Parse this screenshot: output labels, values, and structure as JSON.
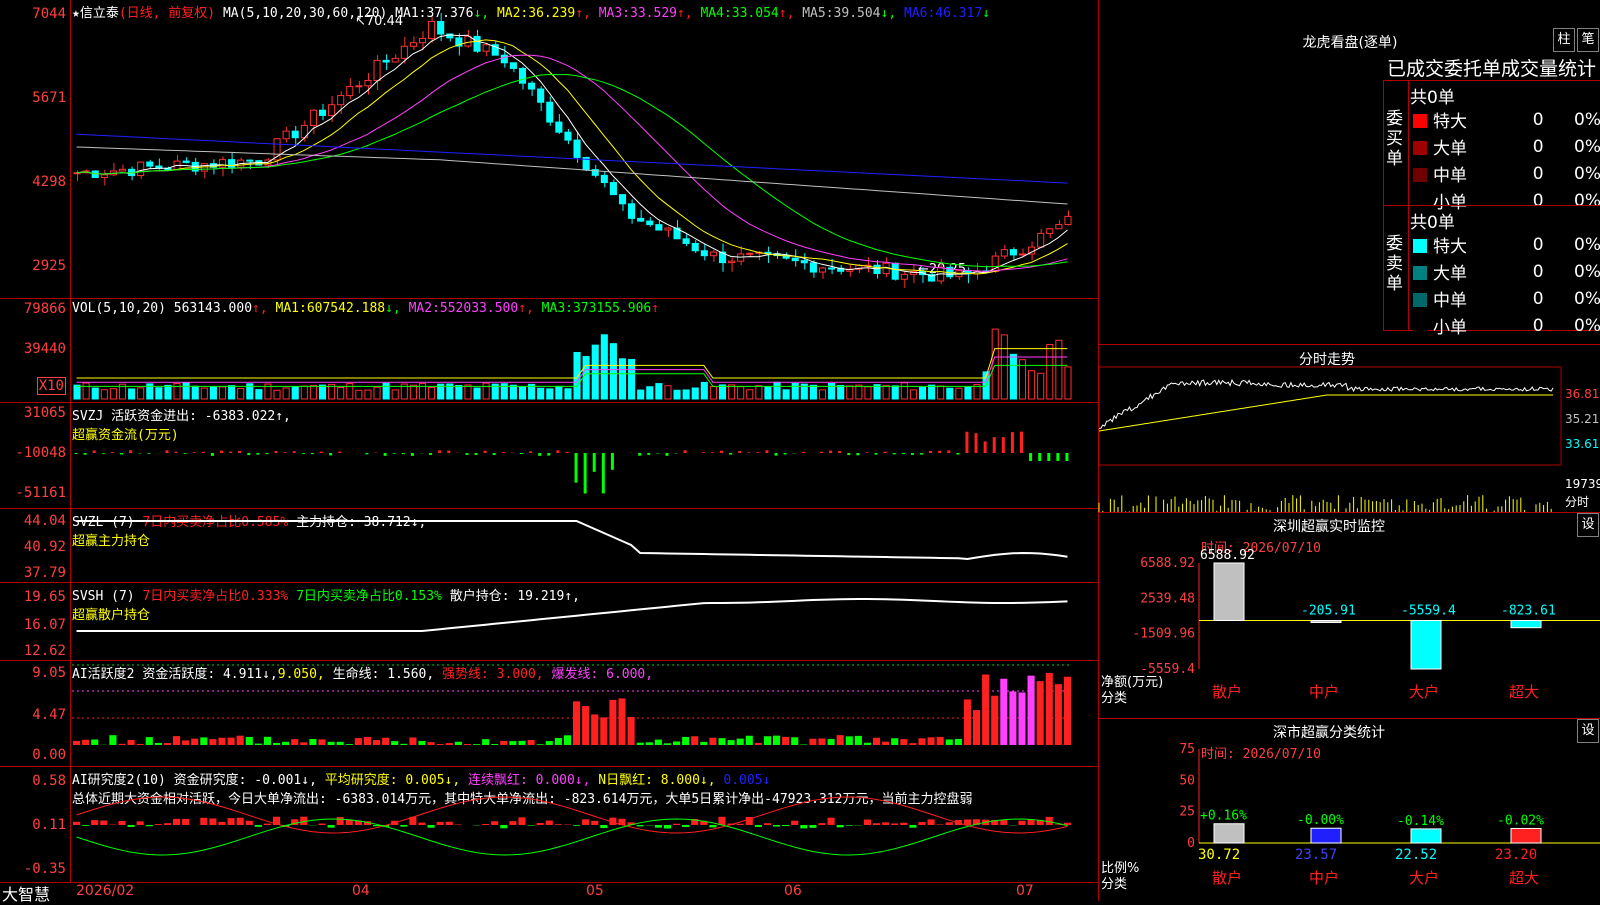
{
  "stock": {
    "title": "★信立泰",
    "mode": "(日线, 前复权)"
  },
  "main_chart": {
    "ma_label": "MA(5,10,20,30,60,120)",
    "ma": [
      {
        "name": "MA1",
        "value": "37.376",
        "arrow": "↓",
        "color": "#ffffff"
      },
      {
        "name": "MA2",
        "value": "36.239",
        "arrow": "↑",
        "color": "#ffff00"
      },
      {
        "name": "MA3",
        "value": "33.529",
        "arrow": "↑",
        "color": "#ff40ff"
      },
      {
        "name": "MA4",
        "value": "33.054",
        "arrow": "↑",
        "color": "#00ff00"
      },
      {
        "name": "MA5",
        "value": "39.504",
        "arrow": "↓",
        "color": "#c0c0c0"
      },
      {
        "name": "MA6",
        "value": "46.317",
        "arrow": "↓",
        "color": "#2020ff"
      }
    ],
    "axis": [
      "7044",
      "5671",
      "4298",
      "2925"
    ],
    "high_label": "70.44",
    "low_label": "←29.25"
  },
  "vol": {
    "legend_name": "VOL(5,10,20)",
    "value": "563143.000",
    "ma": [
      {
        "name": "MA1",
        "value": "607542.188",
        "arrow": "↓"
      },
      {
        "name": "MA2",
        "value": "552033.500",
        "arrow": "↑"
      },
      {
        "name": "MA3",
        "value": "373155.906",
        "arrow": "↑"
      }
    ],
    "axis": [
      "79866",
      "39440"
    ],
    "unit": "X10"
  },
  "svzj": {
    "line1": "SVZJ  活跃资金进出: -6383.022↑,",
    "line2": "超赢资金流(万元)",
    "axis": [
      "31065",
      "-10048",
      "-51161"
    ]
  },
  "svzl": {
    "name": "SVZL (7)",
    "ratio": "7日内买卖净占比0.585%",
    "holding": "主力持仓: 38.712↓,",
    "line2": "超赢主力持仓",
    "axis": [
      "44.04",
      "40.92",
      "37.79"
    ]
  },
  "svsh": {
    "name": "SVSH (7)",
    "ratio1": "7日内买卖净占比0.333%",
    "ratio2": "7日内买卖净占比0.153%",
    "holding": "散户持仓: 19.219↑,",
    "line2": "超赢散户持仓",
    "axis": [
      "19.65",
      "16.07",
      "12.62"
    ]
  },
  "ai1": {
    "name": "AI活跃度2",
    "activity": "资金活跃度: 4.911↓,",
    "v2": "9.050,",
    "life": "生命线: 1.560,",
    "strong": "强势线: 3.000,",
    "burst": "爆发线: 6.000,",
    "axis": [
      "9.05",
      "4.47",
      "0.00"
    ]
  },
  "ai2": {
    "name": "AI研究度2(10)",
    "research": "资金研究度: -0.001↓,",
    "avg": "平均研究度: 0.005↓,",
    "red": "连续飘红: 0.000↓,",
    "nred": "N日飘红: 8.000↓,",
    "last": "0.005↓",
    "summary": "总体近期大资金相对活跃，今日大单净流出: -6383.014万元，其中特大单净流出: -823.614万元，大单5日累计净出-47923.312万元，当前主力控盘弱",
    "axis": [
      "0.58",
      "0.11",
      "-0.35"
    ]
  },
  "bottom": {
    "brand": "大智慧",
    "dates": [
      "2026/02",
      "04",
      "05",
      "06",
      "07"
    ]
  },
  "dragon": {
    "title": "龙虎看盘(逐单)",
    "tab1": "柱",
    "tab2": "笔",
    "subtitle": "已成交委托单成交量统计",
    "buy": {
      "side": "委买单",
      "total": "共0单",
      "rows": [
        {
          "label": "特大",
          "count": "0",
          "pct": "0%",
          "color": "#ff0000"
        },
        {
          "label": "大单",
          "count": "0",
          "pct": "0%",
          "color": "#a00000"
        },
        {
          "label": "中单",
          "count": "0",
          "pct": "0%",
          "color": "#700000"
        },
        {
          "label": "小单",
          "count": "0",
          "pct": "0%",
          "color": "#000000"
        }
      ]
    },
    "sell": {
      "side": "委卖单",
      "total": "共0单",
      "rows": [
        {
          "label": "特大",
          "count": "0",
          "pct": "0%",
          "color": "#00ffff"
        },
        {
          "label": "大单",
          "count": "0",
          "pct": "0%",
          "color": "#008080"
        },
        {
          "label": "中单",
          "count": "0",
          "pct": "0%",
          "color": "#006868"
        },
        {
          "label": "小单",
          "count": "0",
          "pct": "0%",
          "color": "#000000"
        }
      ]
    }
  },
  "intraday": {
    "title": "分时走势",
    "axis": [
      "36.81",
      "35.21",
      "33.61"
    ],
    "vol_label": "19739",
    "tag": "分时"
  },
  "sz_monitor": {
    "title": "深圳超赢实时监控",
    "set": "设",
    "time": "时间: 2026/07/10",
    "axis": [
      "6588.92",
      "2539.48",
      "-1509.96",
      "-5559.4"
    ],
    "unit": "净额(万元)",
    "unit2": "分类",
    "chart_data": {
      "type": "bar",
      "categories": [
        "散户",
        "中户",
        "大户",
        "超大"
      ],
      "values": [
        6588.92,
        -205.91,
        -5559.4,
        -823.61
      ],
      "labels": [
        "6588.92",
        "-205.91",
        "-5559.4",
        "-823.61"
      ],
      "ylim": [
        -5559.4,
        6588.92
      ]
    }
  },
  "sz_class": {
    "title": "深市超赢分类统计",
    "set": "设",
    "time": "时间: 2026/07/10",
    "axis": [
      "75",
      "50",
      "25",
      "0"
    ],
    "unit": "比例%",
    "unit2": "分类",
    "chart_data": {
      "type": "bar",
      "categories": [
        "散户",
        "中户",
        "大户",
        "超大"
      ],
      "values": [
        30.72,
        23.57,
        22.52,
        23.2
      ],
      "values_label": [
        "30.72",
        "23.57",
        "22.52",
        "23.20"
      ],
      "changes": [
        "+0.16%",
        "-0.00%",
        "-0.14%",
        "-0.02%"
      ],
      "ylim": [
        0,
        75
      ]
    }
  }
}
